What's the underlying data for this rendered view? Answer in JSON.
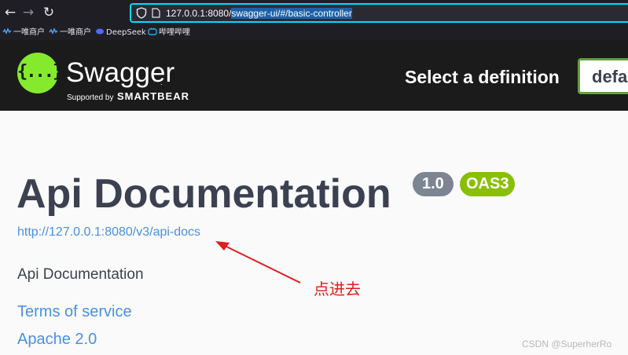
{
  "browser": {
    "back_glyph": "←",
    "forward_glyph": "→",
    "reload_glyph": "↻",
    "url_host": "127.0.0.1:8080/",
    "url_path": "swagger-ui/#/basic-controller",
    "bookmarks": [
      {
        "label": "一唯商户"
      },
      {
        "label": "一唯商户"
      },
      {
        "label": "DeepSeek"
      },
      {
        "label": "哔哩哔哩"
      }
    ]
  },
  "topbar": {
    "brand": "Swagger",
    "brand_dot": ".",
    "supported_by": "Supported by",
    "smartbear": "SMARTBEAR",
    "logo_glyph": "{...}",
    "select_label": "Select a definition",
    "select_value": "default",
    "accent_color": "#85ea2d"
  },
  "info": {
    "title": "Api Documentation",
    "version": "1.0",
    "oas": "OAS3",
    "docs_url": "http://127.0.0.1:8080/v3/api-docs",
    "description": "Api Documentation",
    "terms": "Terms of service",
    "license": "Apache 2.0"
  },
  "annotation": {
    "text": "点进去",
    "color": "#e11d1d"
  },
  "watermark": "CSDN @SuperherRo"
}
